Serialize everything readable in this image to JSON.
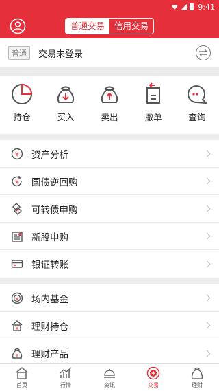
{
  "status_bar": {
    "time": "9:41"
  },
  "header": {
    "segments": [
      {
        "label": "普通交易",
        "active": true
      },
      {
        "label": "信用交易",
        "active": false
      }
    ]
  },
  "account": {
    "tag": "普通",
    "status": "交易未登录"
  },
  "quick_actions": [
    {
      "label": "持仓",
      "icon": "pie-chart-icon"
    },
    {
      "label": "买入",
      "icon": "buy-bag-icon"
    },
    {
      "label": "卖出",
      "icon": "sell-bag-icon"
    },
    {
      "label": "撤单",
      "icon": "cancel-order-icon"
    },
    {
      "label": "查询",
      "icon": "query-icon"
    }
  ],
  "menu_group_1": [
    {
      "label": "资产分析",
      "icon": "asset-analysis-icon"
    },
    {
      "label": "国债逆回购",
      "icon": "repo-icon"
    },
    {
      "label": "可转债申购",
      "icon": "convertible-bond-icon"
    },
    {
      "label": "新股申购",
      "icon": "ipo-icon"
    },
    {
      "label": "银证转账",
      "icon": "bank-transfer-icon"
    }
  ],
  "menu_group_2": [
    {
      "label": "场内基金",
      "icon": "fund-icon"
    },
    {
      "label": "理财持仓",
      "icon": "wealth-holdings-icon"
    },
    {
      "label": "理财产品",
      "icon": "wealth-products-icon"
    }
  ],
  "tabbar": [
    {
      "label": "首页",
      "icon": "home-icon",
      "active": false
    },
    {
      "label": "行情",
      "icon": "market-icon",
      "active": false
    },
    {
      "label": "资讯",
      "icon": "news-icon",
      "active": false
    },
    {
      "label": "交易",
      "icon": "trade-icon",
      "active": true
    },
    {
      "label": "理财",
      "icon": "wealth-icon",
      "active": false
    }
  ],
  "colors": {
    "brand": "#e5303b",
    "background": "#ececec"
  }
}
